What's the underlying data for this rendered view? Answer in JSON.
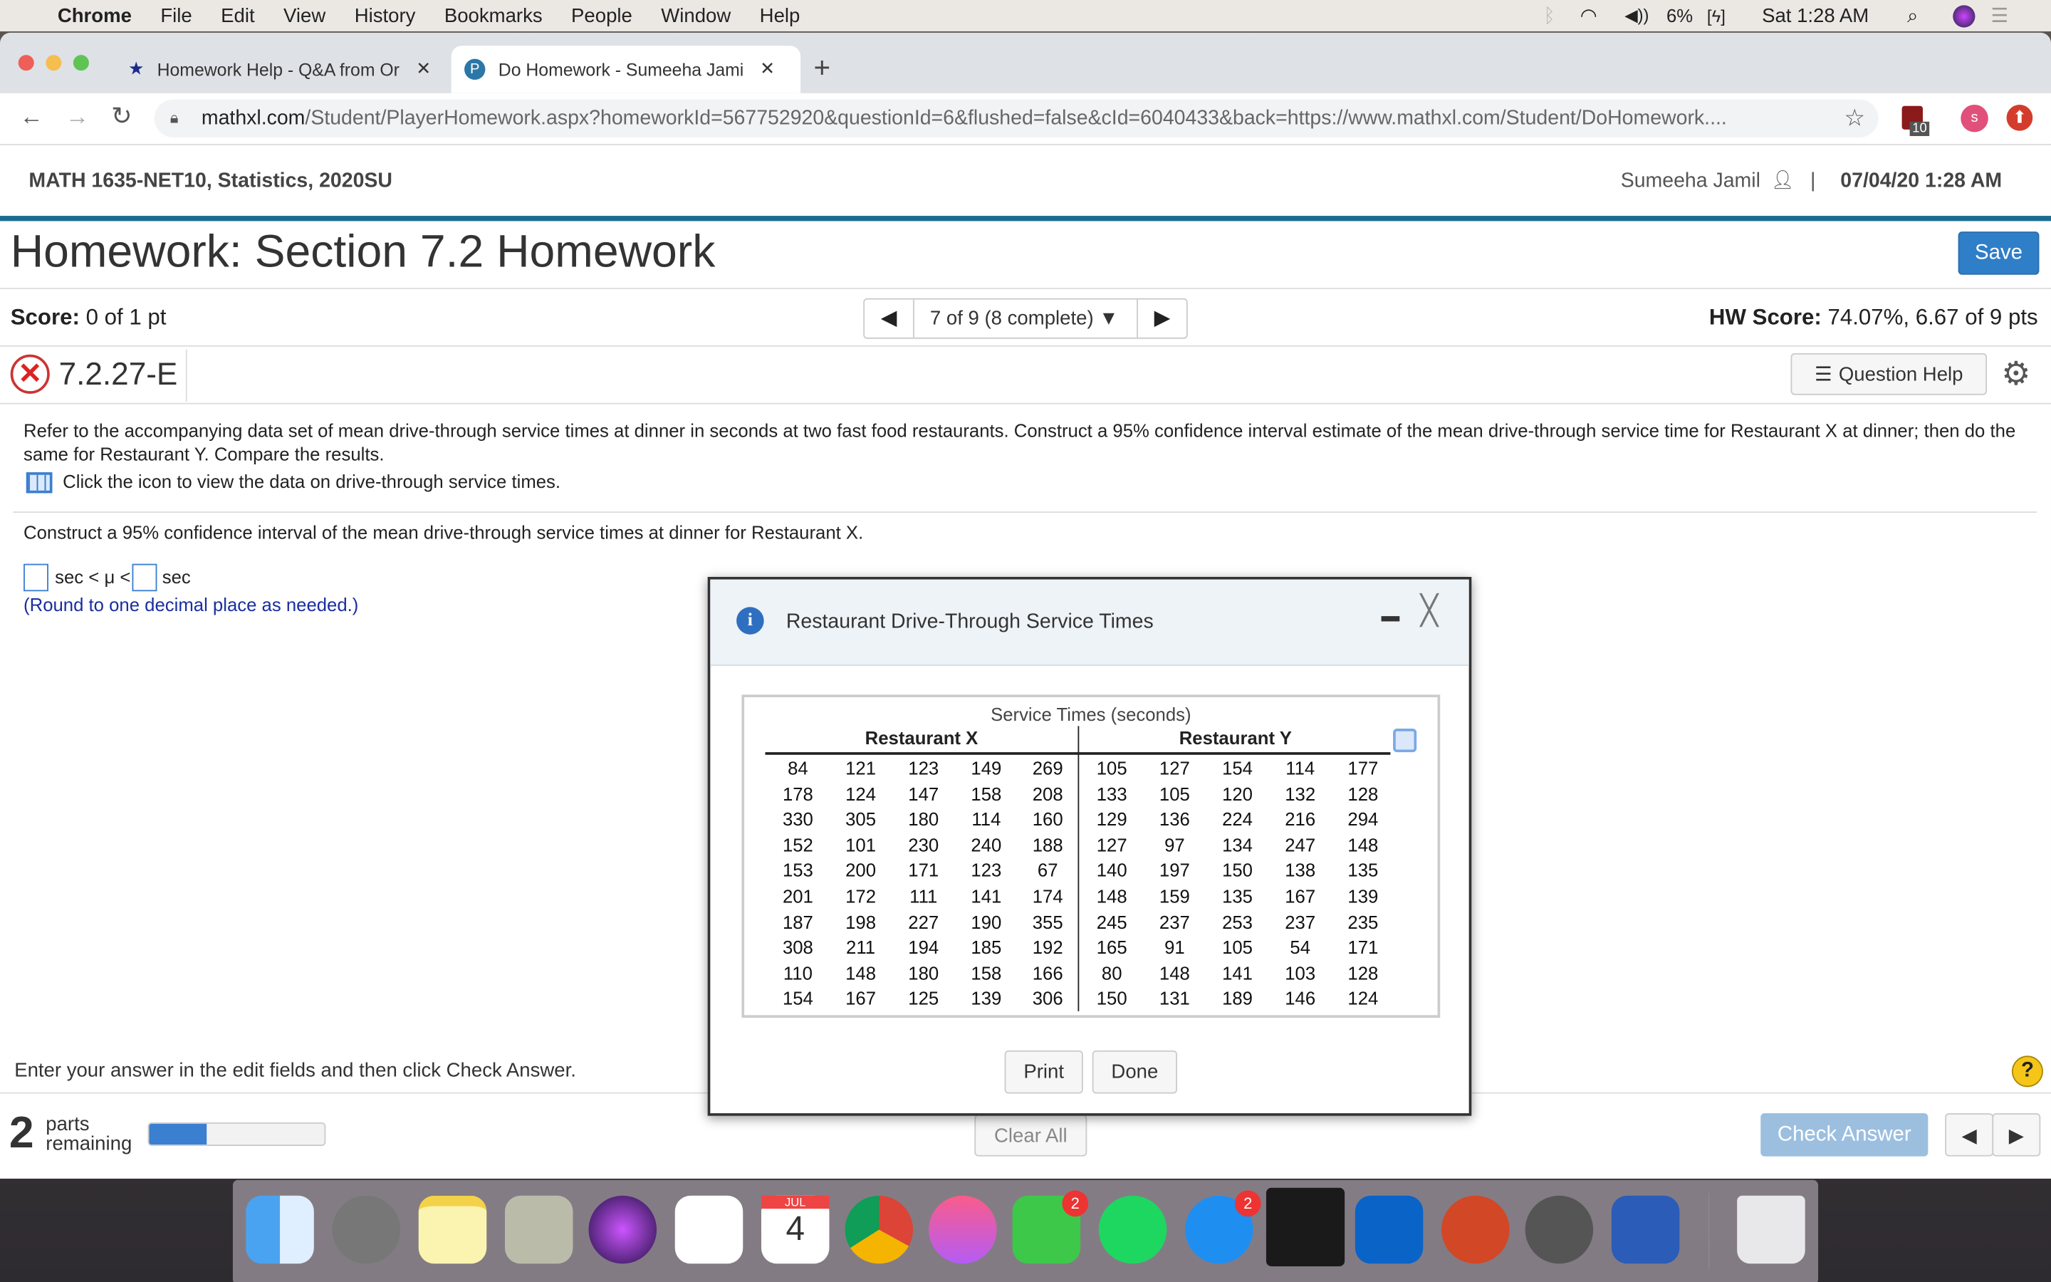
{
  "menubar": {
    "app": "Chrome",
    "items": [
      "File",
      "Edit",
      "View",
      "History",
      "Bookmarks",
      "People",
      "Window",
      "Help"
    ],
    "battery": "6%",
    "clock": "Sat 1:28 AM"
  },
  "tabs": [
    {
      "title": "Homework Help - Q&A from Or"
    },
    {
      "title": "Do Homework - Sumeeha Jami"
    }
  ],
  "address": {
    "domain": "mathxl.com",
    "path": "/Student/PlayerHomework.aspx?homeworkId=567752920&questionId=6&flushed=false&cId=6040433&back=https://www.mathxl.com/Student/DoHomework....",
    "ext_badge": "10",
    "profile_initial": "s"
  },
  "header": {
    "course": "MATH 1635-NET10, Statistics, 2020SU",
    "user": "Sumeeha Jamil",
    "separator": "|",
    "datetime": "07/04/20 1:28 AM"
  },
  "title": "Homework: Section 7.2 Homework",
  "save_label": "Save",
  "score": {
    "label": "Score:",
    "value": "0 of 1 pt",
    "nav": "7 of 9 (8 complete)",
    "hw_label": "HW Score:",
    "hw_value": "74.07%, 6.67 of 9 pts"
  },
  "question": {
    "id": "7.2.27-E",
    "help_label": "Question Help",
    "text": "Refer to the accompanying data set of mean drive-through service times at dinner in seconds at two fast food restaurants. Construct a 95% confidence interval estimate of the mean drive-through service time for Restaurant X at dinner; then do the same for Restaurant Y. Compare the results.",
    "data_link": "Click the icon to view the data on drive-through service times.",
    "part": "Construct a 95% confidence interval of the mean drive-through service times at dinner for Restaurant X.",
    "unit1": "sec < μ <",
    "unit2": "sec",
    "hint": "(Round to one decimal place as needed.)"
  },
  "footer": {
    "instruction": "Enter your answer in the edit fields and then click Check Answer.",
    "parts_count": "2",
    "parts_label1": "parts",
    "parts_label2": "remaining",
    "progress": 0.33,
    "clear_label": "Clear All",
    "check_label": "Check Answer"
  },
  "dialog": {
    "title": "Restaurant Drive-Through Service Times",
    "caption": "Service Times (seconds)",
    "col_x": "Restaurant X",
    "col_y": "Restaurant Y",
    "print_label": "Print",
    "done_label": "Done",
    "rows": [
      [
        84,
        121,
        123,
        149,
        269,
        105,
        127,
        154,
        114,
        177
      ],
      [
        178,
        124,
        147,
        158,
        208,
        133,
        105,
        120,
        132,
        128
      ],
      [
        330,
        305,
        180,
        114,
        160,
        129,
        136,
        224,
        216,
        294
      ],
      [
        152,
        101,
        230,
        240,
        188,
        127,
        97,
        134,
        247,
        148
      ],
      [
        153,
        200,
        171,
        123,
        67,
        140,
        197,
        150,
        138,
        135
      ],
      [
        201,
        172,
        111,
        141,
        174,
        148,
        159,
        135,
        167,
        139
      ],
      [
        187,
        198,
        227,
        190,
        355,
        245,
        237,
        253,
        237,
        235
      ],
      [
        308,
        211,
        194,
        185,
        192,
        165,
        91,
        105,
        54,
        171
      ],
      [
        110,
        148,
        180,
        158,
        166,
        80,
        148,
        141,
        103,
        128
      ],
      [
        154,
        167,
        125,
        139,
        306,
        150,
        131,
        189,
        146,
        124
      ]
    ]
  },
  "dock": {
    "calendar_month": "JUL",
    "calendar_day": "4",
    "facetime_badge": "2",
    "appstore_badge": "2"
  }
}
